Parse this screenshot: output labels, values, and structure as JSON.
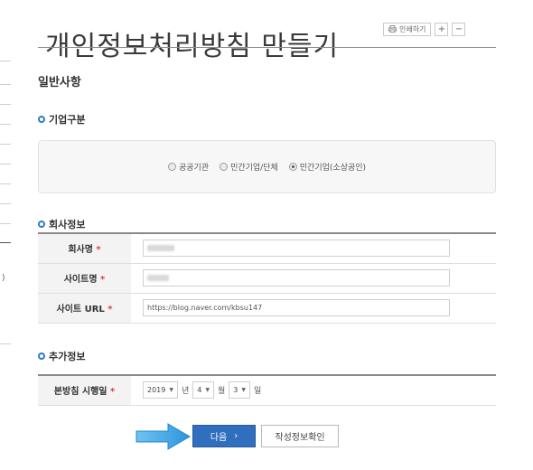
{
  "page": {
    "title": "개인정보처리방침 만들기",
    "print_label": "인쇄하기",
    "zoom_in_label": "+",
    "zoom_out_label": "−",
    "sidebar_fragment": ")"
  },
  "general": {
    "heading": "일반사항",
    "company_type": {
      "label": "기업구분",
      "options": [
        {
          "label": "공공기관",
          "selected": false
        },
        {
          "label": "민간기업/단체",
          "selected": false
        },
        {
          "label": "민간기업(소상공인)",
          "selected": true
        }
      ]
    },
    "company_info": {
      "label": "회사정보",
      "fields": [
        {
          "label": "회사명",
          "required_mark": "*",
          "value": ""
        },
        {
          "label": "사이트명",
          "required_mark": "*",
          "value": ""
        },
        {
          "label": "사이트 URL",
          "required_mark": "*",
          "value": "https://blog.naver.com/kbsu147"
        }
      ]
    },
    "extra_info": {
      "label": "추가정보",
      "effective_date": {
        "label": "본방침 시행일",
        "required_mark": "*",
        "year": "2019",
        "year_unit": "년",
        "month": "4",
        "month_unit": "월",
        "day": "3",
        "day_unit": "일"
      }
    }
  },
  "actions": {
    "next_label": "다음",
    "next_chevron": "›",
    "confirm_label": "작성정보확인"
  },
  "colors": {
    "accent": "#2f6fbd",
    "arrow": "#3a9de0",
    "required": "#e04040"
  }
}
